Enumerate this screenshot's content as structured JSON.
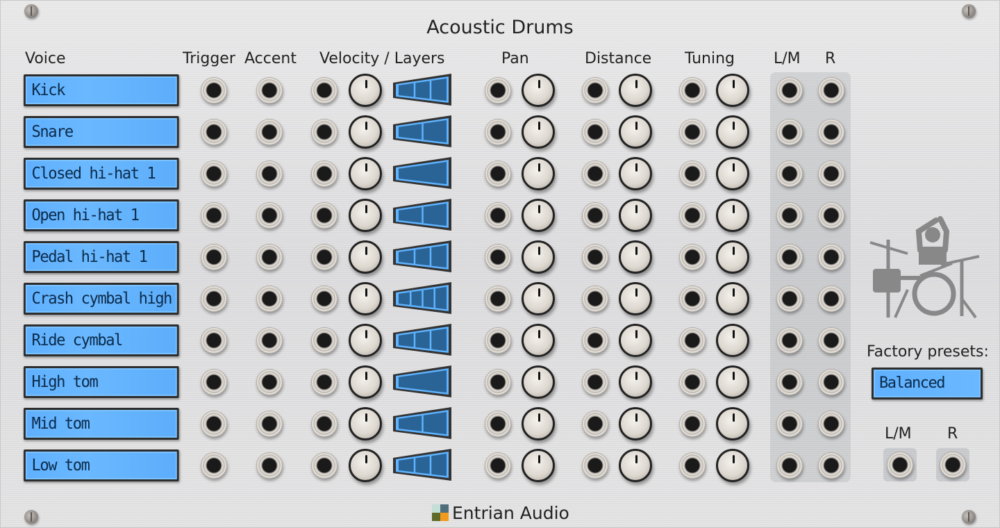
{
  "module": {
    "title": "Acoustic Drums",
    "brand": "Entrian Audio",
    "brand_logo_colors": [
      "#c5ded6",
      "#4f6e7c",
      "#5f6a2a",
      "#f29a1d"
    ]
  },
  "headers": {
    "voice": "Voice",
    "trigger": "Trigger",
    "accent": "Accent",
    "velocity_layers": "Velocity / Layers",
    "pan": "Pan",
    "distance": "Distance",
    "tuning": "Tuning",
    "out_left": "L/M",
    "out_right": "R"
  },
  "voices": [
    {
      "name": "Kick",
      "layers": 3
    },
    {
      "name": "Snare",
      "layers": 2
    },
    {
      "name": "Closed hi-hat 1",
      "layers": 1
    },
    {
      "name": "Open hi-hat 1",
      "layers": 2
    },
    {
      "name": "Pedal hi-hat 1",
      "layers": 3
    },
    {
      "name": "Crash cymbal high",
      "layers": 4
    },
    {
      "name": "Ride cymbal",
      "layers": 3
    },
    {
      "name": "High tom",
      "layers": 1
    },
    {
      "name": "Mid tom",
      "layers": 2
    },
    {
      "name": "Low tom",
      "layers": 3
    }
  ],
  "knob_positions": {
    "velocity": "center",
    "pan": "center",
    "distance": "center",
    "tuning": "center"
  },
  "presets": {
    "label": "Factory presets:",
    "value": "Balanced"
  },
  "master_out": {
    "left": "L/M",
    "right": "R"
  },
  "icons": {
    "drummer": "drummer-icon",
    "screw": "screw-icon",
    "jack": "jack-socket-icon",
    "knob": "rotary-knob"
  },
  "colors": {
    "lcd_bg": "#62b3ff",
    "lcd_text": "#0c2b4a",
    "layers_fill": "#2a6496",
    "layers_border": "#5fb3ff",
    "drummer": "#888888"
  }
}
